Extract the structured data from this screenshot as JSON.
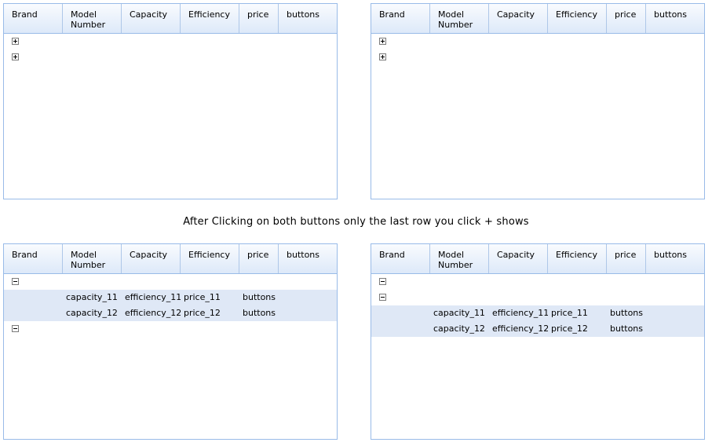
{
  "columns": [
    "Brand",
    "Model\nNumber",
    "Capacity",
    "Efficiency",
    "price",
    "buttons"
  ],
  "caption": "After Clicking on both buttons only the last row you click + shows",
  "expanded_rows": [
    {
      "capacity": "capacity_11",
      "efficiency": "efficiency_11",
      "price": "price_11",
      "buttons": "buttons h"
    },
    {
      "capacity": "capacity_12",
      "efficiency": "efficiency_12",
      "price": "price_12",
      "buttons": "buttons h"
    }
  ],
  "icons": {
    "expand": "plus-box-icon",
    "collapse": "minus-box-icon"
  },
  "colors": {
    "header_border": "#99bbe8",
    "row_highlight": "#dfe8f6"
  }
}
